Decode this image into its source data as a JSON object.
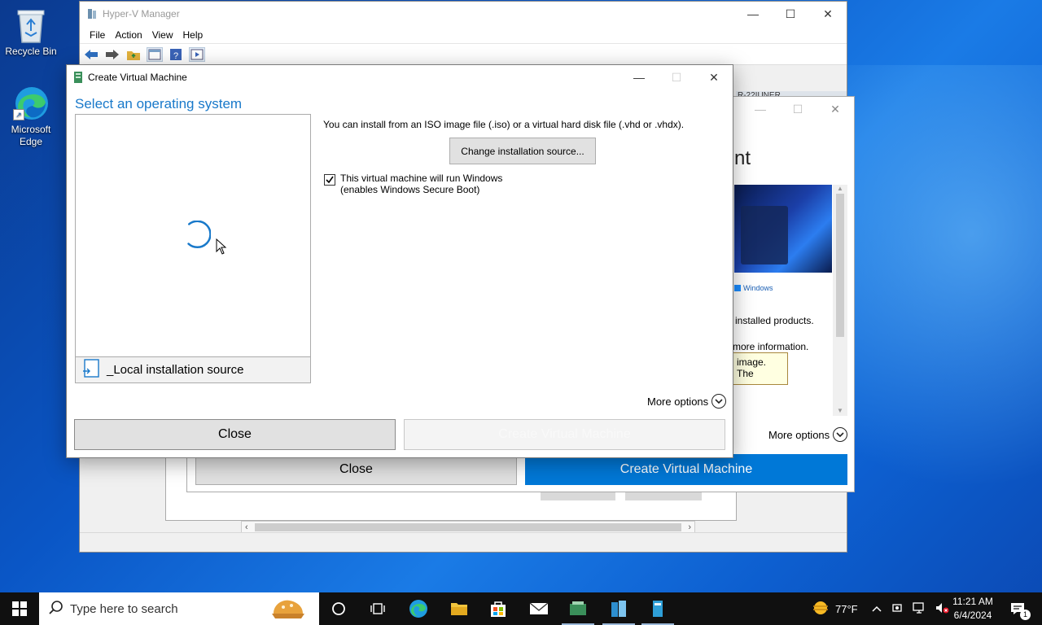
{
  "desktop": {
    "icons": [
      {
        "label": "Recycle Bin"
      },
      {
        "label": "Microsoft Edge"
      }
    ]
  },
  "hyperv": {
    "title": "Hyper-V Manager",
    "menu": [
      "File",
      "Action",
      "View",
      "Help"
    ],
    "partial_header_text": "R-22IUNER"
  },
  "back_wizard": {
    "heading_fragment": "nt",
    "brand_text": "Windows",
    "text_installed": "installed products.",
    "text_more_info": "more information.",
    "tooltip_text": "image. The",
    "more_options": "More options",
    "close_label": "Close",
    "create_label": "Create Virtual Machine",
    "accent": "#0078d7"
  },
  "dialog": {
    "title": "Create Virtual Machine",
    "heading": "Select an operating system",
    "description": "You can install from an ISO image file (.iso) or a virtual hard disk file (.vhd or .vhdx).",
    "change_source_label": "Change installation source...",
    "windows_checkbox": {
      "checked": true,
      "line1": "This virtual machine will run Windows",
      "line2": "(enables Windows Secure Boot)"
    },
    "local_source_label": "_Local installation source",
    "more_options": "More options",
    "close_label": "Close",
    "create_label": "Create Virtual Machine",
    "heading_color": "#1979ca"
  },
  "taskbar": {
    "search_placeholder": "Type here to search",
    "weather": "77°F",
    "time": "11:21 AM",
    "date": "6/4/2024",
    "notification_count": "1"
  }
}
